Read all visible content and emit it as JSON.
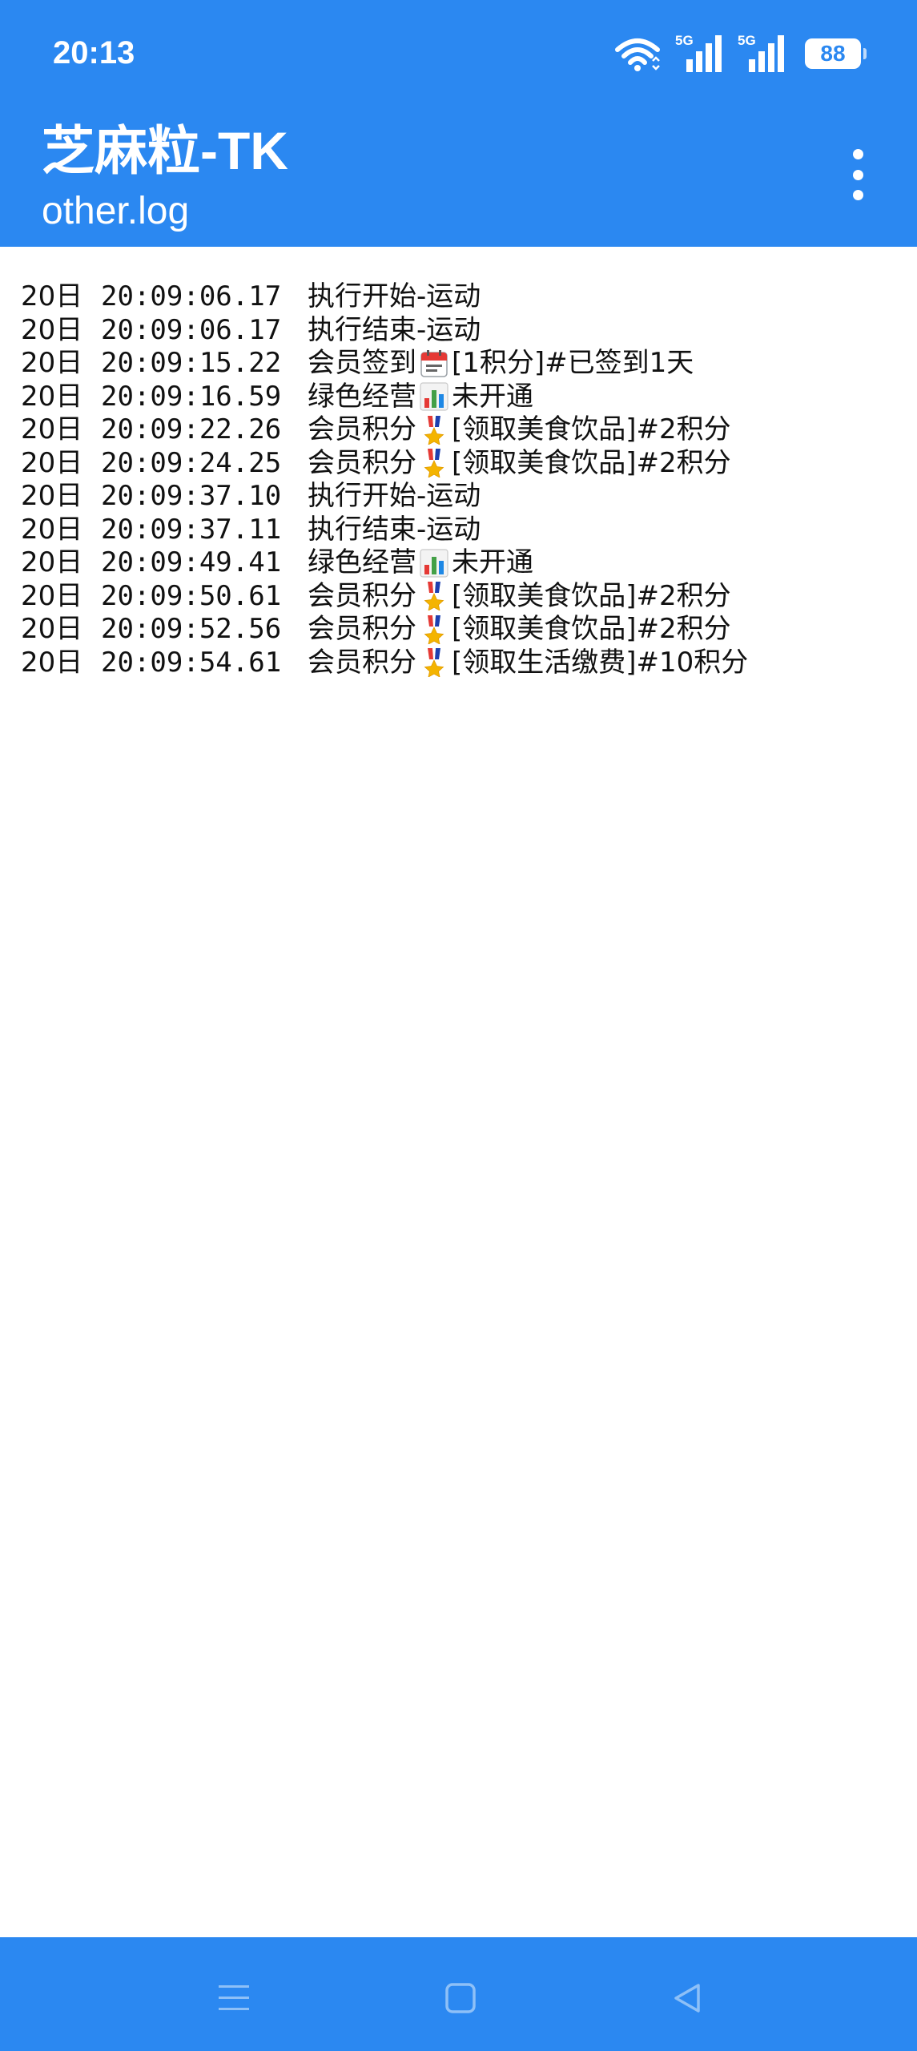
{
  "status_bar": {
    "time": "20:13",
    "signal_1_tag": "5G",
    "signal_2_tag": "5G",
    "battery": "88",
    "icons": [
      "wifi-icon",
      "signal-icon",
      "signal-icon",
      "battery-icon"
    ]
  },
  "app_bar": {
    "title": "芝麻粒-TK",
    "subtitle": "other.log",
    "menu_icon": "more-vert-icon"
  },
  "colors": {
    "bar": "#2b88f1",
    "background": "#ffffff",
    "text": "#111111"
  },
  "log": [
    {
      "day": "20日",
      "time": "20:09:06.17",
      "pre": "执行开始-运动",
      "emoji": "",
      "post": ""
    },
    {
      "day": "20日",
      "time": "20:09:06.17",
      "pre": "执行结束-运动",
      "emoji": "",
      "post": ""
    },
    {
      "day": "20日",
      "time": "20:09:15.22",
      "pre": "会员签到",
      "emoji": "calendar-icon",
      "post": "[1积分]#已签到1天"
    },
    {
      "day": "20日",
      "time": "20:09:16.59",
      "pre": "绿色经营",
      "emoji": "bar-chart-icon",
      "post": "未开通"
    },
    {
      "day": "20日",
      "time": "20:09:22.26",
      "pre": "会员积分",
      "emoji": "medal-icon",
      "post": "[领取美食饮品]#2积分"
    },
    {
      "day": "20日",
      "time": "20:09:24.25",
      "pre": "会员积分",
      "emoji": "medal-icon",
      "post": "[领取美食饮品]#2积分"
    },
    {
      "day": "20日",
      "time": "20:09:37.10",
      "pre": "执行开始-运动",
      "emoji": "",
      "post": ""
    },
    {
      "day": "20日",
      "time": "20:09:37.11",
      "pre": "执行结束-运动",
      "emoji": "",
      "post": ""
    },
    {
      "day": "20日",
      "time": "20:09:49.41",
      "pre": "绿色经营",
      "emoji": "bar-chart-icon",
      "post": "未开通"
    },
    {
      "day": "20日",
      "time": "20:09:50.61",
      "pre": "会员积分",
      "emoji": "medal-icon",
      "post": "[领取美食饮品]#2积分"
    },
    {
      "day": "20日",
      "time": "20:09:52.56",
      "pre": "会员积分",
      "emoji": "medal-icon",
      "post": "[领取美食饮品]#2积分"
    },
    {
      "day": "20日",
      "time": "20:09:54.61",
      "pre": "会员积分",
      "emoji": "medal-icon",
      "post": "[领取生活缴费]#10积分"
    }
  ],
  "nav_bar": {
    "icons": [
      "menu-icon",
      "home-icon",
      "back-icon"
    ]
  }
}
